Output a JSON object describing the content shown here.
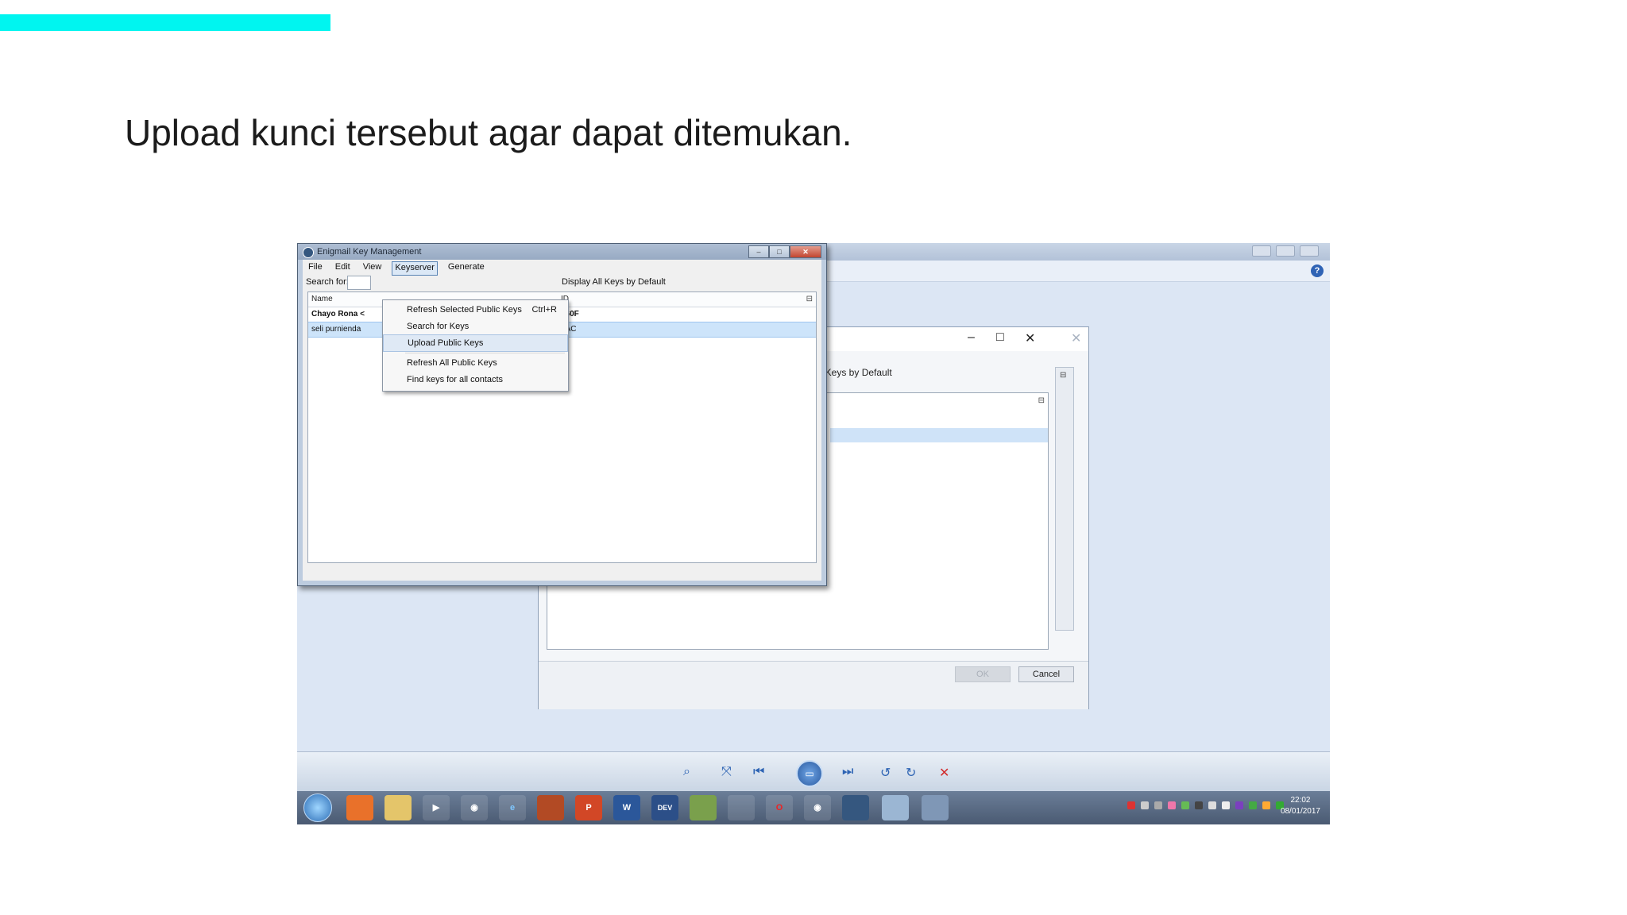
{
  "slide": {
    "title": "Upload kunci tersebut agar dapat ditemukan.",
    "accent_color": "#00f5f0"
  },
  "key_manager": {
    "window_title": "Enigmail Key Management",
    "menu": [
      "File",
      "Edit",
      "View",
      "Keyserver",
      "Generate"
    ],
    "active_menu": "Keyserver",
    "search_label": "Search for:",
    "display_all_label": "Display All Keys by Default",
    "columns": {
      "name": "Name",
      "id": "ID"
    },
    "rows": [
      {
        "name": "Chayo Rona <",
        "id": "160F",
        "selected": false
      },
      {
        "name": "seli purnienda",
        "id": "5AC",
        "selected": true
      }
    ]
  },
  "keyserver_menu": {
    "items": [
      {
        "label": "Refresh Selected Public Keys",
        "shortcut": "Ctrl+R"
      },
      {
        "label": "Search for Keys",
        "shortcut": ""
      },
      {
        "label": "Upload Public Keys",
        "shortcut": "",
        "highlighted": true
      },
      {
        "label": "Refresh All Public Keys",
        "shortcut": ""
      },
      {
        "label": "Find keys for all contacts",
        "shortcut": ""
      }
    ]
  },
  "background_dialog": {
    "display_all_label": "All Keys by Default",
    "ok_label": "OK",
    "cancel_label": "Cancel"
  },
  "player": {
    "controls": [
      "zoom-icon",
      "fit-icon",
      "prev-icon",
      "slideshow-icon",
      "next-icon",
      "rotate-left-icon",
      "rotate-right-icon",
      "delete-icon"
    ]
  },
  "taskbar": {
    "apps": [
      "xampp",
      "explorer",
      "media",
      "chrome",
      "ie",
      "firefox",
      "P",
      "W",
      "DEV",
      "app",
      "app2",
      "opera",
      "chrome2",
      "thunderbird",
      "vm",
      "app3"
    ],
    "clock_time": "22:02",
    "clock_date": "08/01/2017"
  }
}
